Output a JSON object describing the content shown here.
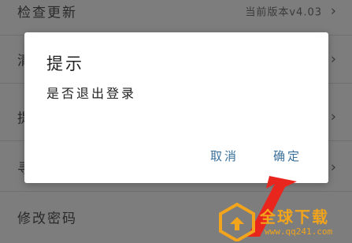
{
  "settings": {
    "rows": [
      {
        "label": "检查更新",
        "value": "当前版本v4.03"
      },
      {
        "label": "清"
      },
      {
        "label": "提"
      },
      {
        "label": "寻"
      },
      {
        "label": "修改密码"
      }
    ]
  },
  "dialog": {
    "title": "提示",
    "message": "是否退出登录",
    "cancel_label": "取消",
    "confirm_label": "确定"
  },
  "watermark": {
    "brand": "全球下载",
    "url": "www.qq241.com"
  },
  "colors": {
    "accent": "#3a6f99",
    "arrow": "#e8261e",
    "watermark": "#f2a41c"
  }
}
